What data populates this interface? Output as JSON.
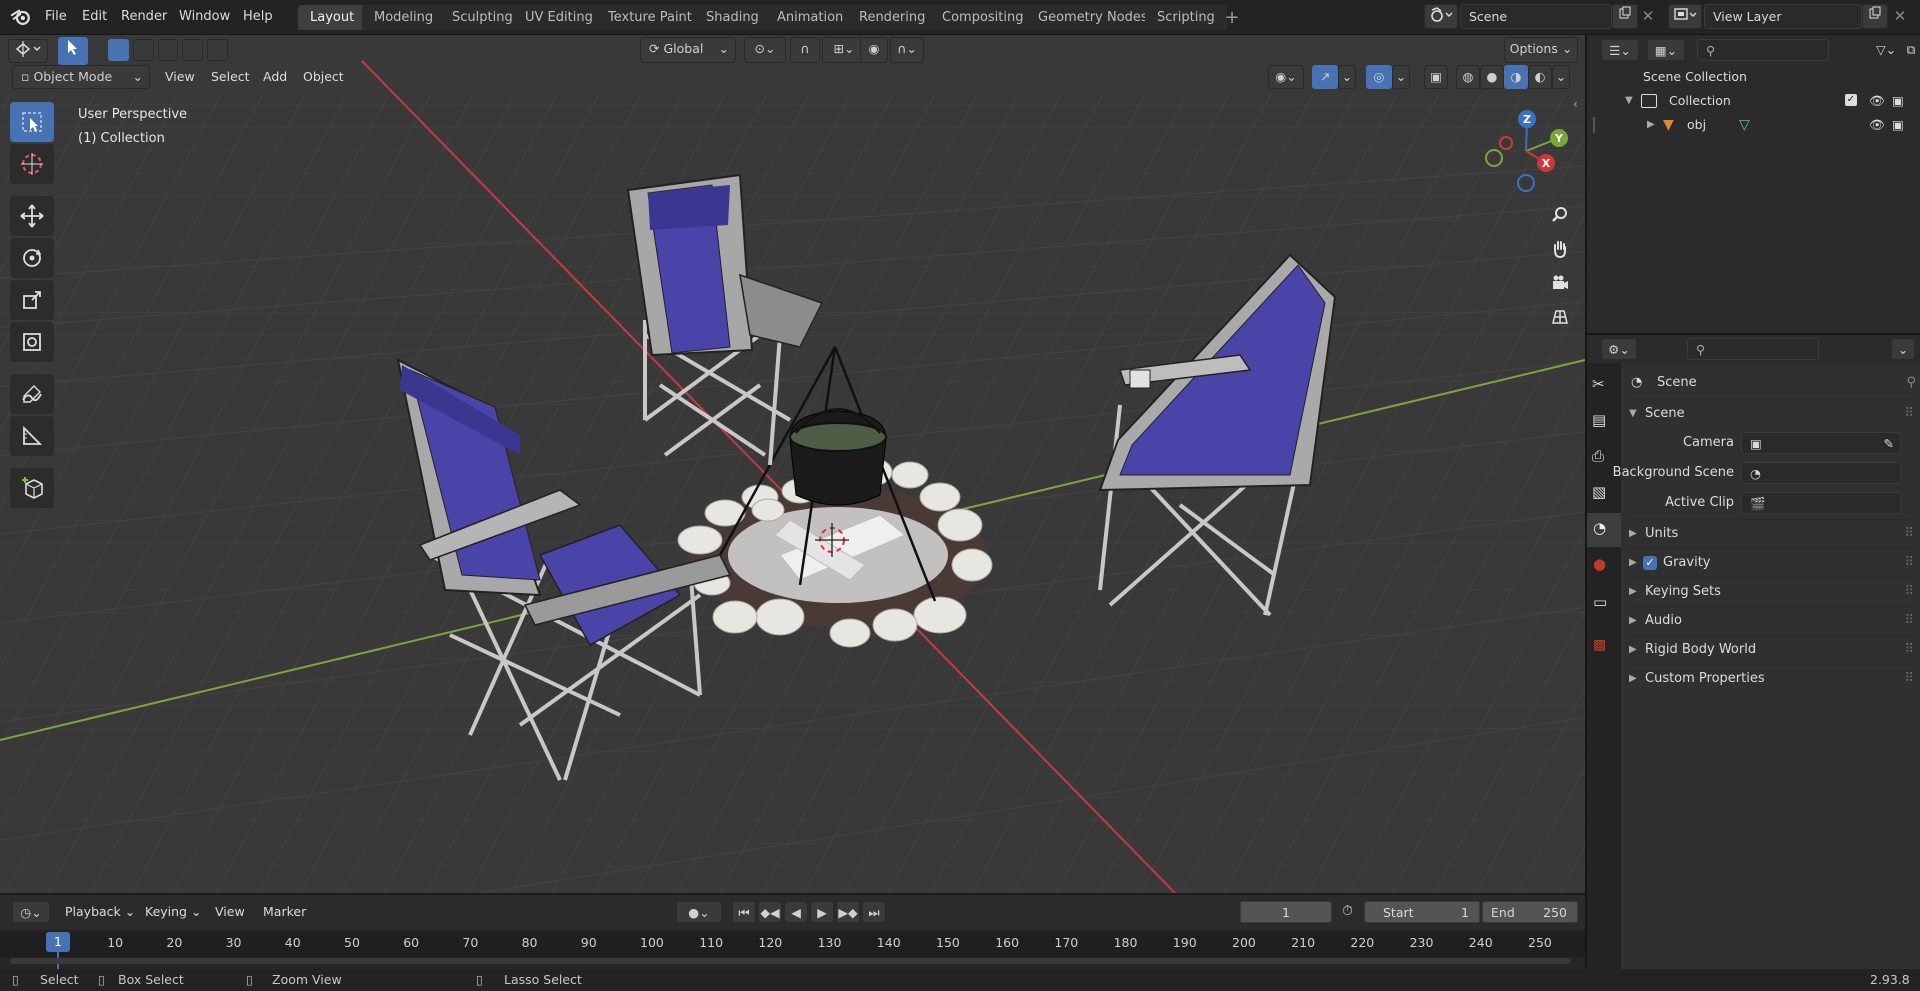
{
  "menu": {
    "file": "File",
    "edit": "Edit",
    "render": "Render",
    "window": "Window",
    "help": "Help"
  },
  "workspaces": [
    "Layout",
    "Modeling",
    "Sculpting",
    "UV Editing",
    "Texture Paint",
    "Shading",
    "Animation",
    "Rendering",
    "Compositing",
    "Geometry Nodes",
    "Scripting"
  ],
  "scene_selector": "Scene",
  "view_layer": "View Layer",
  "viewport": {
    "transform_orientation": "Global",
    "options_label": "Options",
    "mode": "Object Mode",
    "menus": [
      "View",
      "Select",
      "Add",
      "Object"
    ],
    "overlay_line1": "User Perspective",
    "overlay_line2": "(1) Collection",
    "gizmo": {
      "z": "Z",
      "y": "Y",
      "x": "X"
    }
  },
  "outliner": {
    "scene_collection": "Scene Collection",
    "collection": "Collection",
    "object": "obj"
  },
  "properties": {
    "context": "Scene",
    "panel_title": "Scene",
    "camera_label": "Camera",
    "background_scene_label": "Background Scene",
    "active_clip_label": "Active Clip",
    "sections": [
      "Units",
      "Gravity",
      "Keying Sets",
      "Audio",
      "Rigid Body World",
      "Custom Properties"
    ],
    "gravity_enabled": true
  },
  "timeline": {
    "menus": [
      "Playback",
      "Keying",
      "View",
      "Marker"
    ],
    "current_frame": "1",
    "start_label": "Start",
    "start_value": "1",
    "end_label": "End",
    "end_value": "250",
    "ruler_current": "1",
    "ruler_ticks": [
      "10",
      "20",
      "30",
      "40",
      "50",
      "60",
      "70",
      "80",
      "90",
      "100",
      "110",
      "120",
      "130",
      "140",
      "150",
      "160",
      "170",
      "180",
      "190",
      "200",
      "210",
      "220",
      "230",
      "240",
      "250"
    ]
  },
  "status": {
    "select": "Select",
    "box_select": "Box Select",
    "zoom_view": "Zoom View",
    "lasso_select": "Lasso Select",
    "version": "2.93.8"
  },
  "colors": {
    "accent": "#4772b3",
    "x_axis": "#c83a3a",
    "y_axis": "#7aa63a",
    "z_axis": "#3a72c8",
    "chair_fabric": "#4a43a8"
  }
}
